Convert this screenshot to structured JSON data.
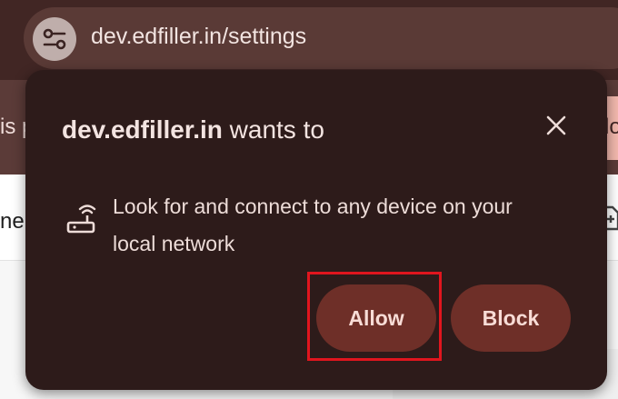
{
  "browser": {
    "url": "dev.edfiller.in/settings",
    "site_info_icon": "tune-icon"
  },
  "background_page": {
    "infobar_text_fragment": "is p",
    "infobar_pill_text": "lo",
    "content_text_fragment": "ne"
  },
  "permission_popup": {
    "site": "dev.edfiller.in",
    "title_suffix": " wants to",
    "permission_icon": "router-icon",
    "permission_text": "Look for and connect to any device on your local network",
    "allow_label": "Allow",
    "block_label": "Block",
    "close_icon": "close-icon"
  },
  "colors": {
    "popup_bg": "#2d1b1a",
    "button_bg": "#6e2f28",
    "button_text": "#f8dcd6",
    "highlight": "#e0151e"
  }
}
